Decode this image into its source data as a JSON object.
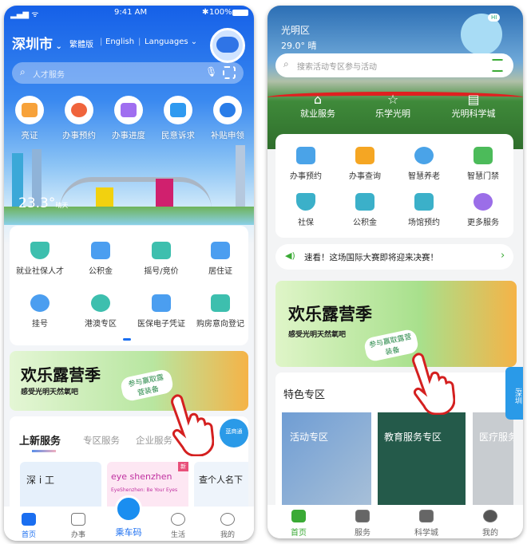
{
  "left_phone": {
    "status": {
      "time": "9:41 AM",
      "battery": "100%"
    },
    "city": "深圳市",
    "lang_options": [
      "繁體版",
      "English",
      "Languages"
    ],
    "search_placeholder": "人才服务",
    "quick": [
      {
        "label": "亮证",
        "color": "#f7a23a"
      },
      {
        "label": "办事预约",
        "color": "#f0643c"
      },
      {
        "label": "办事进度",
        "color": "#a06ef0"
      },
      {
        "label": "民意诉求",
        "color": "#2f9af0"
      },
      {
        "label": "补贴申领",
        "color": "#2a7de8"
      }
    ],
    "weather": {
      "temp": "23.3°",
      "desc": "晴天"
    },
    "grid": [
      {
        "label": "就业社保人才",
        "color": "#3dbfae"
      },
      {
        "label": "公积金",
        "color": "#4b9ef0"
      },
      {
        "label": "摇号/竞价",
        "color": "#3dbfae"
      },
      {
        "label": "居住证",
        "color": "#4b9ef0"
      },
      {
        "label": "挂号",
        "color": "#4b9ef0"
      },
      {
        "label": "港澳专区",
        "color": "#3dbfae"
      },
      {
        "label": "医保电子凭证",
        "color": "#4b9ef0"
      },
      {
        "label": "购房意向登记",
        "color": "#3dbfae"
      }
    ],
    "banner": {
      "title": "欢乐露营季",
      "subtitle": "感受光明天然氧吧",
      "bubble": "参与赢取露营装备"
    },
    "tabs": [
      "上新服务",
      "专区服务",
      "企业服务"
    ],
    "float_button": "蓝商通",
    "service_cards": [
      {
        "title": "深 i 工"
      },
      {
        "title": "eye shenzhen",
        "sub": "EyeShenzhen: Be Your Eyes",
        "badge": "新"
      },
      {
        "title": "查个人名下"
      }
    ],
    "nav": [
      {
        "label": "首页",
        "active": true
      },
      {
        "label": "办事"
      },
      {
        "label": "乘车码"
      },
      {
        "label": "生活"
      },
      {
        "label": "我的"
      }
    ],
    "accent": "#1a6ef0"
  },
  "right_phone": {
    "district": "光明区",
    "weather": "29.0° 晴",
    "mascot_badge": "HI",
    "search_placeholder": "搜索活动专区参与活动",
    "top_links": [
      "就业服务",
      "乐学光明",
      "光明科学城"
    ],
    "grid": [
      {
        "label": "办事预约",
        "color": "#4aa3e8"
      },
      {
        "label": "办事查询",
        "color": "#f5a623"
      },
      {
        "label": "智慧养老",
        "color": "#4aa3e8"
      },
      {
        "label": "智慧门禁",
        "color": "#4cbb5a"
      },
      {
        "label": "社保",
        "color": "#3bb0c9"
      },
      {
        "label": "公积金",
        "color": "#3bb0c9"
      },
      {
        "label": "场馆预约",
        "color": "#3bb0c9"
      },
      {
        "label": "更多服务",
        "color": "#9b6ee8"
      }
    ],
    "notice": "速看！这场国际大赛即将迎来决赛！",
    "banner": {
      "title": "欢乐露营季",
      "subtitle": "感受光明天然氧吧",
      "bubble": "参与赢取露营装备"
    },
    "section_title": "特色专区",
    "zones": [
      "活动专区",
      "教育服务专区",
      "医疗服务"
    ],
    "side_tab": "i深圳",
    "nav": [
      {
        "label": "首页",
        "active": true
      },
      {
        "label": "服务"
      },
      {
        "label": "科学城"
      },
      {
        "label": "我的"
      }
    ],
    "accent": "#3aaa35"
  }
}
